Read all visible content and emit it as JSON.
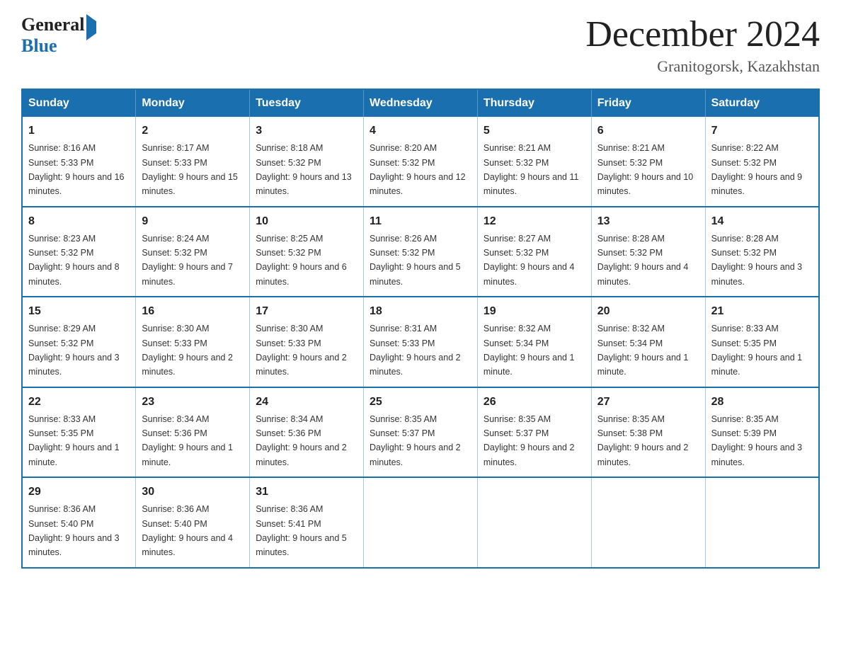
{
  "header": {
    "logo": {
      "general": "General",
      "blue": "Blue"
    },
    "title": "December 2024",
    "location": "Granitogorsk, Kazakhstan"
  },
  "calendar": {
    "days_of_week": [
      "Sunday",
      "Monday",
      "Tuesday",
      "Wednesday",
      "Thursday",
      "Friday",
      "Saturday"
    ],
    "weeks": [
      [
        {
          "day": "1",
          "sunrise": "8:16 AM",
          "sunset": "5:33 PM",
          "daylight": "9 hours and 16 minutes."
        },
        {
          "day": "2",
          "sunrise": "8:17 AM",
          "sunset": "5:33 PM",
          "daylight": "9 hours and 15 minutes."
        },
        {
          "day": "3",
          "sunrise": "8:18 AM",
          "sunset": "5:32 PM",
          "daylight": "9 hours and 13 minutes."
        },
        {
          "day": "4",
          "sunrise": "8:20 AM",
          "sunset": "5:32 PM",
          "daylight": "9 hours and 12 minutes."
        },
        {
          "day": "5",
          "sunrise": "8:21 AM",
          "sunset": "5:32 PM",
          "daylight": "9 hours and 11 minutes."
        },
        {
          "day": "6",
          "sunrise": "8:21 AM",
          "sunset": "5:32 PM",
          "daylight": "9 hours and 10 minutes."
        },
        {
          "day": "7",
          "sunrise": "8:22 AM",
          "sunset": "5:32 PM",
          "daylight": "9 hours and 9 minutes."
        }
      ],
      [
        {
          "day": "8",
          "sunrise": "8:23 AM",
          "sunset": "5:32 PM",
          "daylight": "9 hours and 8 minutes."
        },
        {
          "day": "9",
          "sunrise": "8:24 AM",
          "sunset": "5:32 PM",
          "daylight": "9 hours and 7 minutes."
        },
        {
          "day": "10",
          "sunrise": "8:25 AM",
          "sunset": "5:32 PM",
          "daylight": "9 hours and 6 minutes."
        },
        {
          "day": "11",
          "sunrise": "8:26 AM",
          "sunset": "5:32 PM",
          "daylight": "9 hours and 5 minutes."
        },
        {
          "day": "12",
          "sunrise": "8:27 AM",
          "sunset": "5:32 PM",
          "daylight": "9 hours and 4 minutes."
        },
        {
          "day": "13",
          "sunrise": "8:28 AM",
          "sunset": "5:32 PM",
          "daylight": "9 hours and 4 minutes."
        },
        {
          "day": "14",
          "sunrise": "8:28 AM",
          "sunset": "5:32 PM",
          "daylight": "9 hours and 3 minutes."
        }
      ],
      [
        {
          "day": "15",
          "sunrise": "8:29 AM",
          "sunset": "5:32 PM",
          "daylight": "9 hours and 3 minutes."
        },
        {
          "day": "16",
          "sunrise": "8:30 AM",
          "sunset": "5:33 PM",
          "daylight": "9 hours and 2 minutes."
        },
        {
          "day": "17",
          "sunrise": "8:30 AM",
          "sunset": "5:33 PM",
          "daylight": "9 hours and 2 minutes."
        },
        {
          "day": "18",
          "sunrise": "8:31 AM",
          "sunset": "5:33 PM",
          "daylight": "9 hours and 2 minutes."
        },
        {
          "day": "19",
          "sunrise": "8:32 AM",
          "sunset": "5:34 PM",
          "daylight": "9 hours and 1 minute."
        },
        {
          "day": "20",
          "sunrise": "8:32 AM",
          "sunset": "5:34 PM",
          "daylight": "9 hours and 1 minute."
        },
        {
          "day": "21",
          "sunrise": "8:33 AM",
          "sunset": "5:35 PM",
          "daylight": "9 hours and 1 minute."
        }
      ],
      [
        {
          "day": "22",
          "sunrise": "8:33 AM",
          "sunset": "5:35 PM",
          "daylight": "9 hours and 1 minute."
        },
        {
          "day": "23",
          "sunrise": "8:34 AM",
          "sunset": "5:36 PM",
          "daylight": "9 hours and 1 minute."
        },
        {
          "day": "24",
          "sunrise": "8:34 AM",
          "sunset": "5:36 PM",
          "daylight": "9 hours and 2 minutes."
        },
        {
          "day": "25",
          "sunrise": "8:35 AM",
          "sunset": "5:37 PM",
          "daylight": "9 hours and 2 minutes."
        },
        {
          "day": "26",
          "sunrise": "8:35 AM",
          "sunset": "5:37 PM",
          "daylight": "9 hours and 2 minutes."
        },
        {
          "day": "27",
          "sunrise": "8:35 AM",
          "sunset": "5:38 PM",
          "daylight": "9 hours and 2 minutes."
        },
        {
          "day": "28",
          "sunrise": "8:35 AM",
          "sunset": "5:39 PM",
          "daylight": "9 hours and 3 minutes."
        }
      ],
      [
        {
          "day": "29",
          "sunrise": "8:36 AM",
          "sunset": "5:40 PM",
          "daylight": "9 hours and 3 minutes."
        },
        {
          "day": "30",
          "sunrise": "8:36 AM",
          "sunset": "5:40 PM",
          "daylight": "9 hours and 4 minutes."
        },
        {
          "day": "31",
          "sunrise": "8:36 AM",
          "sunset": "5:41 PM",
          "daylight": "9 hours and 5 minutes."
        },
        null,
        null,
        null,
        null
      ]
    ]
  }
}
